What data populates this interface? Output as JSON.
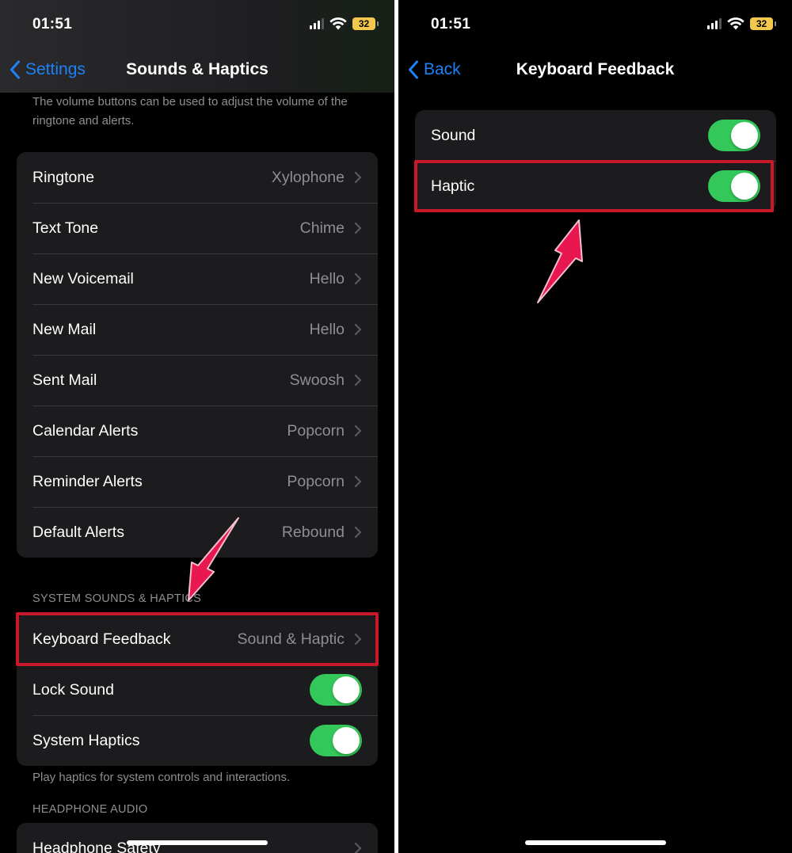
{
  "left_screen": {
    "status": {
      "time": "01:51",
      "battery": "32"
    },
    "nav": {
      "back_label": "Settings",
      "title": "Sounds & Haptics"
    },
    "volume_footnote": "The volume buttons can be used to adjust the volume of the ringtone and alerts.",
    "tones": [
      {
        "label": "Ringtone",
        "value": "Xylophone"
      },
      {
        "label": "Text Tone",
        "value": "Chime"
      },
      {
        "label": "New Voicemail",
        "value": "Hello"
      },
      {
        "label": "New Mail",
        "value": "Hello"
      },
      {
        "label": "Sent Mail",
        "value": "Swoosh"
      },
      {
        "label": "Calendar Alerts",
        "value": "Popcorn"
      },
      {
        "label": "Reminder Alerts",
        "value": "Popcorn"
      },
      {
        "label": "Default Alerts",
        "value": "Rebound"
      }
    ],
    "system_section_header": "SYSTEM SOUNDS & HAPTICS",
    "keyboard_feedback": {
      "label": "Keyboard Feedback",
      "value": "Sound & Haptic"
    },
    "lock_sound": {
      "label": "Lock Sound",
      "on": true
    },
    "system_haptics": {
      "label": "System Haptics",
      "on": true
    },
    "haptics_footnote": "Play haptics for system controls and interactions.",
    "headphone_section_header": "HEADPHONE AUDIO",
    "headphone_safety": {
      "label": "Headphone Safety"
    }
  },
  "right_screen": {
    "status": {
      "time": "01:51",
      "battery": "32"
    },
    "nav": {
      "back_label": "Back",
      "title": "Keyboard Feedback"
    },
    "sound": {
      "label": "Sound",
      "on": true
    },
    "haptic": {
      "label": "Haptic",
      "on": true
    }
  },
  "colors": {
    "accent_blue": "#1c82f7",
    "toggle_on": "#34c759",
    "highlight_red": "#c8182a",
    "arrow_pink": "#e8174f",
    "cell_background": "#1c1c1e",
    "secondary_text": "#8e8e93",
    "battery_yellow": "#f2c94c"
  },
  "icons": [
    "back-chevron-icon",
    "disclosure-chevron-icon",
    "cellular-signal-icon",
    "wifi-icon",
    "battery-icon",
    "annotation-arrow-icon"
  ]
}
